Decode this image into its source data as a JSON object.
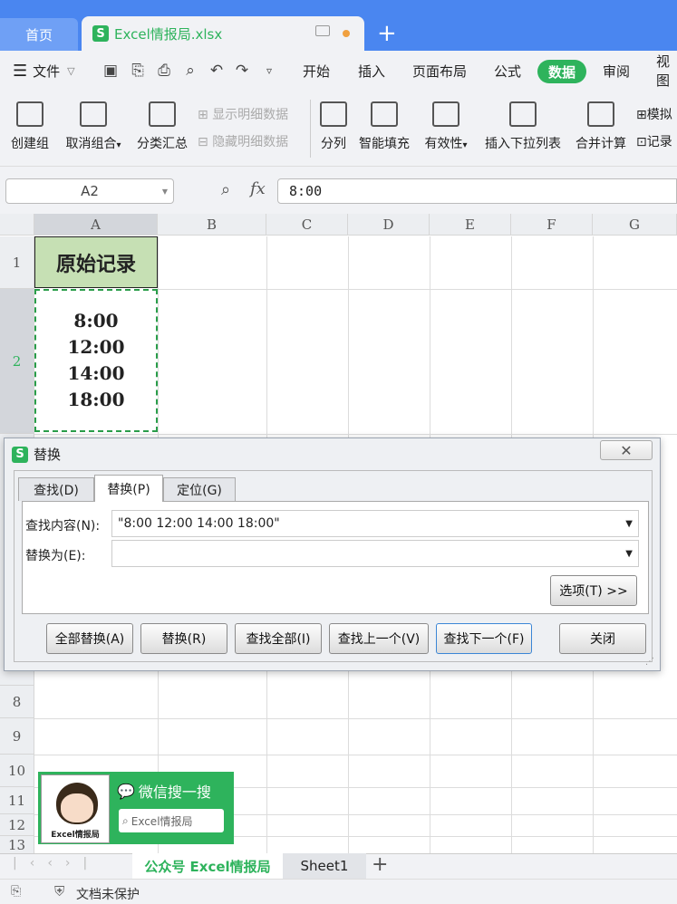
{
  "tabs": {
    "home": "首页",
    "file": "Excel情报局.xlsx",
    "new_tab": "+"
  },
  "menu": {
    "file": "文件",
    "items": [
      "开始",
      "插入",
      "页面布局",
      "公式",
      "数据",
      "审阅",
      "视图"
    ],
    "active": "数据"
  },
  "ribbon": {
    "create_group": "创建组",
    "ungroup": "取消组合",
    "ungroup_arrow": "▾",
    "subtotal": "分类汇总",
    "show_detail": "显示明细数据",
    "hide_detail": "隐藏明细数据",
    "split": "分列",
    "flash_fill": "智能填充",
    "validation": "有效性",
    "validation_arrow": "▾",
    "insert_dropdown": "插入下拉列表",
    "consolidate": "合并计算",
    "simulate": "模拟",
    "record": "记录"
  },
  "formula_bar": {
    "name_box": "A2",
    "fx": "fx",
    "value": "8:00"
  },
  "columns": [
    "A",
    "B",
    "C",
    "D",
    "E",
    "F",
    "G"
  ],
  "rows": [
    "1",
    "2",
    "8",
    "9",
    "10",
    "11",
    "12",
    "13"
  ],
  "cells": {
    "a1": "原始记录",
    "a2": [
      "8:00",
      "12:00",
      "14:00",
      "18:00"
    ]
  },
  "dialog": {
    "title": "替换",
    "close_glyph": "✕",
    "tabs": [
      "查找(D)",
      "替换(P)",
      "定位(G)"
    ],
    "find_label": "查找内容(N):",
    "find_value": "\"8:00 12:00 14:00 18:00\"",
    "replace_label": "替换为(E):",
    "replace_value": "",
    "options": "选项(T) >>",
    "buttons": [
      "全部替换(A)",
      "替换(R)",
      "查找全部(I)",
      "查找上一个(V)",
      "查找下一个(F)",
      "关闭"
    ]
  },
  "promo": {
    "title": "微信搜一搜",
    "search": "Excel情报局",
    "caption": "Excel情报局"
  },
  "sheets": [
    "公众号 Excel情报局",
    "Sheet1"
  ],
  "status": {
    "protect": "文档未保护"
  },
  "colors": {
    "brand_green": "#2eb35c",
    "title_blue": "#4a86f0",
    "a1_fill": "#c6e0b4"
  }
}
